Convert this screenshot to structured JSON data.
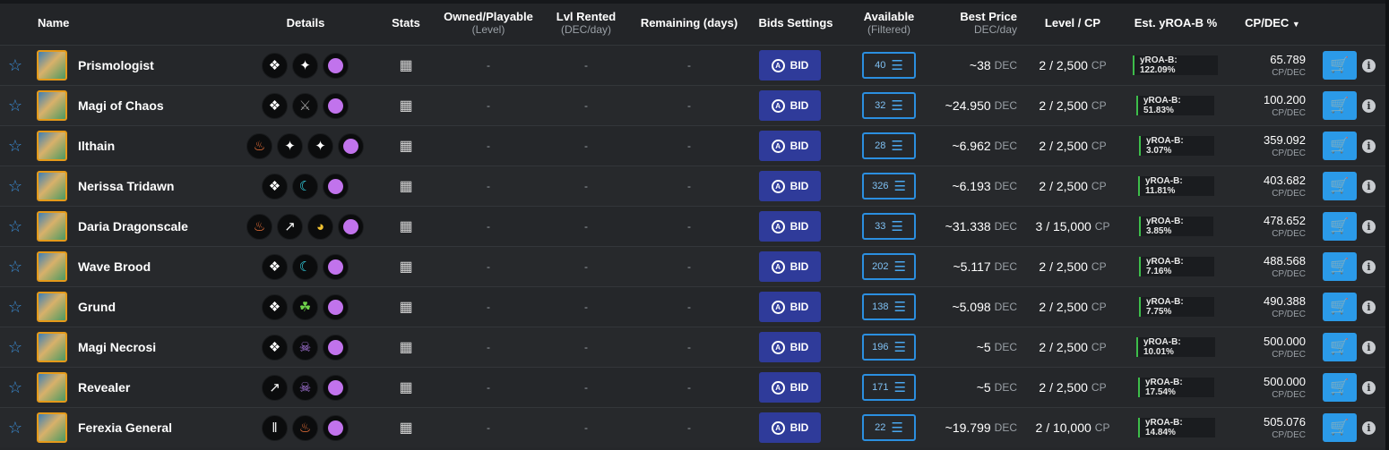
{
  "header": {
    "name": "Name",
    "details": "Details",
    "stats": "Stats",
    "owned": "Owned/Playable",
    "owned_sub": "(Level)",
    "rented": "Lvl Rented",
    "rented_sub": "(DEC/day)",
    "remaining": "Remaining (days)",
    "bids": "Bids Settings",
    "available": "Available",
    "available_sub": "(Filtered)",
    "best_price": "Best Price",
    "best_price_sub": "DEC/day",
    "level_cp": "Level / CP",
    "yroa": "Est. yROA-B %",
    "cpdec": "CP/DEC",
    "sort_icon": "chevron-down-icon"
  },
  "common": {
    "dash": "-",
    "bid_label": "BID",
    "dec_unit": "DEC",
    "cp_unit": "CP",
    "cpdec_unit": "CP/DEC",
    "star_icon": "star-outline-icon",
    "stats_icon": "stats-chart-icon",
    "cart_icon": "add-to-cart-icon",
    "info_icon": "info-icon"
  },
  "colors": {
    "bid_button": "#2f3b9a",
    "available_border": "#2b8fe0",
    "cart_button": "#2b9ae8",
    "roa_bar": "#3dbd4a",
    "avatar_border": "#e59a1a",
    "magic_dot": "#c173ec"
  },
  "rows": [
    {
      "name": "Prismologist",
      "icons": [
        "summoner-icon",
        "ability-icon",
        "magic-icon"
      ],
      "available": "40",
      "price": "~38",
      "level": "2 / 2,500",
      "roa": "yROA-B: 122.09%",
      "cpdec": "65.789"
    },
    {
      "name": "Magi of Chaos",
      "icons": [
        "summoner-icon",
        "crossed-swords-icon",
        "magic-icon"
      ],
      "available": "32",
      "price": "~24.950",
      "level": "2 / 2,500",
      "roa": "yROA-B: 51.83%",
      "cpdec": "100.200"
    },
    {
      "name": "Ilthain",
      "icons": [
        "fire-icon",
        "ability-icon",
        "ability-icon",
        "magic-icon"
      ],
      "available": "28",
      "price": "~6.962",
      "level": "2 / 2,500",
      "roa": "yROA-B: 3.07%",
      "cpdec": "359.092"
    },
    {
      "name": "Nerissa Tridawn",
      "icons": [
        "summoner-icon",
        "water-icon",
        "magic-icon"
      ],
      "available": "326",
      "price": "~6.193",
      "level": "2 / 2,500",
      "roa": "yROA-B: 11.81%",
      "cpdec": "403.682"
    },
    {
      "name": "Daria Dragonscale",
      "icons": [
        "fire-icon",
        "rarity-icon",
        "dragon-icon",
        "magic-icon"
      ],
      "available": "33",
      "price": "~31.338",
      "level": "3 / 15,000",
      "roa": "yROA-B: 3.85%",
      "cpdec": "478.652"
    },
    {
      "name": "Wave Brood",
      "icons": [
        "summoner-icon",
        "water-icon",
        "magic-icon"
      ],
      "available": "202",
      "price": "~5.117",
      "level": "2 / 2,500",
      "roa": "yROA-B: 7.16%",
      "cpdec": "488.568"
    },
    {
      "name": "Grund",
      "icons": [
        "summoner-icon",
        "earth-icon",
        "magic-icon"
      ],
      "available": "138",
      "price": "~5.098",
      "level": "2 / 2,500",
      "roa": "yROA-B: 7.75%",
      "cpdec": "490.388"
    },
    {
      "name": "Magi Necrosi",
      "icons": [
        "summoner-icon",
        "death-icon",
        "magic-icon"
      ],
      "available": "196",
      "price": "~5",
      "level": "2 / 2,500",
      "roa": "yROA-B: 10.01%",
      "cpdec": "500.000"
    },
    {
      "name": "Revealer",
      "icons": [
        "rarity-icon",
        "death-icon",
        "magic-icon"
      ],
      "available": "171",
      "price": "~5",
      "level": "2 / 2,500",
      "roa": "yROA-B: 17.54%",
      "cpdec": "500.000"
    },
    {
      "name": "Ferexia General",
      "icons": [
        "edition-icon",
        "fire-icon",
        "magic-icon"
      ],
      "available": "22",
      "price": "~19.799",
      "level": "2 / 10,000",
      "roa": "yROA-B: 14.84%",
      "cpdec": "505.076"
    }
  ]
}
